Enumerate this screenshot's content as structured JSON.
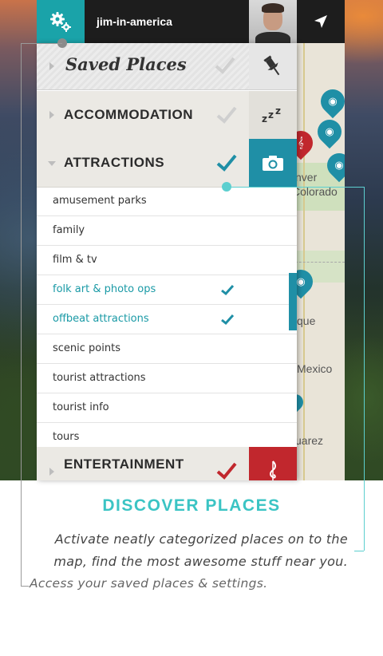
{
  "user": {
    "name": "jim-in-america"
  },
  "icons": {
    "settings": "gears-icon",
    "navigate": "location-arrow-icon",
    "saved": "pushpin-icon",
    "accommodation": "sleep-zzz-icon",
    "attractions": "camera-icon",
    "entertainment": "music-note-icon"
  },
  "panel": {
    "saved_title": "Saved Places",
    "categories": [
      {
        "label": "ACCOMMODATION",
        "checked": false,
        "accent": "#e6e4df"
      },
      {
        "label": "ATTRACTIONS",
        "checked": true,
        "accent": "#1f8fa6"
      },
      {
        "label": "ENTERTAINMENT",
        "checked": true,
        "accent": "#c1272d"
      }
    ],
    "subcategories": [
      {
        "label": "amusement parks",
        "checked": false
      },
      {
        "label": "family",
        "checked": false
      },
      {
        "label": "film & tv",
        "checked": false
      },
      {
        "label": "folk art & photo ops",
        "checked": true
      },
      {
        "label": "offbeat attractions",
        "checked": true
      },
      {
        "label": "scenic points",
        "checked": false
      },
      {
        "label": "tourist attractions",
        "checked": false
      },
      {
        "label": "tourist info",
        "checked": false
      },
      {
        "label": "tours",
        "checked": false
      }
    ]
  },
  "map": {
    "labels": [
      "nver",
      "Colorado",
      "que",
      "Mexico",
      "uarez"
    ]
  },
  "caption": {
    "heading": "DISCOVER PLACES",
    "line1": "Activate neatly categorized places on to the",
    "line2": "map, find the most awesome stuff near you.",
    "line3": "Access your saved places & settings."
  },
  "colors": {
    "teal": "#1aa3a9",
    "teal_dark": "#1f8fa6",
    "red": "#c1272d",
    "heading": "#3bc4c4",
    "callout_teal": "#5ccfcf",
    "callout_gray": "#9a9a9a"
  }
}
